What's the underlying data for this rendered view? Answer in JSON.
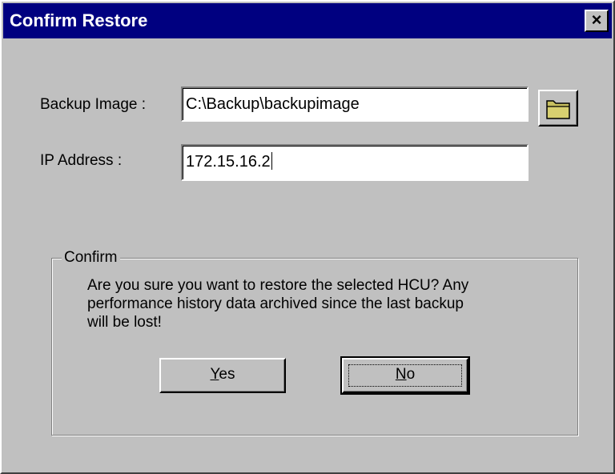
{
  "window": {
    "title": "Confirm Restore",
    "close_glyph": "×"
  },
  "form": {
    "backup_label": "Backup Image :",
    "backup_value": "C:\\Backup\\backupimage",
    "ip_label": "IP Address :",
    "ip_value": "172.15.16.2",
    "browse_icon": "folder-icon"
  },
  "confirm": {
    "group_label": "Confirm",
    "message_lines": [
      "Are you sure you want to restore the selected HCU? Any",
      "performance history data archived since the last backup",
      "will be lost!"
    ],
    "yes_mnemonic": "Y",
    "yes_rest": "es",
    "no_mnemonic": "N",
    "no_rest": "o"
  },
  "colors": {
    "titlebar": "#000080",
    "face": "#c0c0c0",
    "folder": "#c8c060"
  }
}
